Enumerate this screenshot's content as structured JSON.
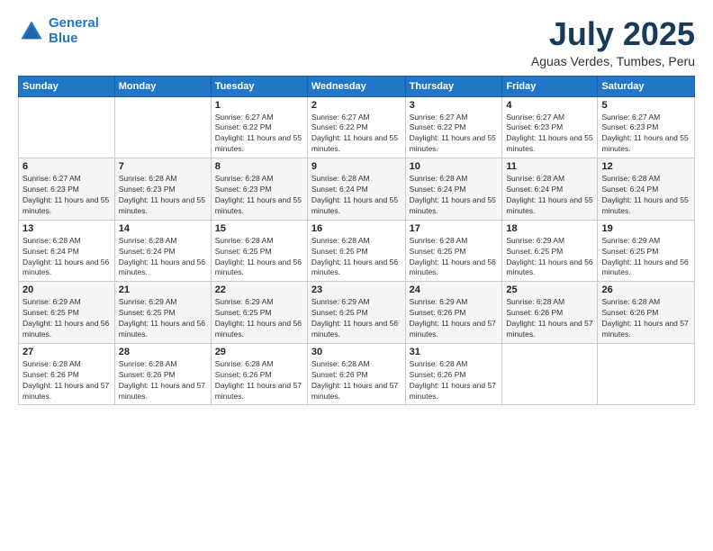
{
  "header": {
    "logo_line1": "General",
    "logo_line2": "Blue",
    "month_title": "July 2025",
    "subtitle": "Aguas Verdes, Tumbes, Peru"
  },
  "days_of_week": [
    "Sunday",
    "Monday",
    "Tuesday",
    "Wednesday",
    "Thursday",
    "Friday",
    "Saturday"
  ],
  "weeks": [
    [
      {
        "day": "",
        "info": ""
      },
      {
        "day": "",
        "info": ""
      },
      {
        "day": "1",
        "info": "Sunrise: 6:27 AM\nSunset: 6:22 PM\nDaylight: 11 hours and 55 minutes."
      },
      {
        "day": "2",
        "info": "Sunrise: 6:27 AM\nSunset: 6:22 PM\nDaylight: 11 hours and 55 minutes."
      },
      {
        "day": "3",
        "info": "Sunrise: 6:27 AM\nSunset: 6:22 PM\nDaylight: 11 hours and 55 minutes."
      },
      {
        "day": "4",
        "info": "Sunrise: 6:27 AM\nSunset: 6:23 PM\nDaylight: 11 hours and 55 minutes."
      },
      {
        "day": "5",
        "info": "Sunrise: 6:27 AM\nSunset: 6:23 PM\nDaylight: 11 hours and 55 minutes."
      }
    ],
    [
      {
        "day": "6",
        "info": "Sunrise: 6:27 AM\nSunset: 6:23 PM\nDaylight: 11 hours and 55 minutes."
      },
      {
        "day": "7",
        "info": "Sunrise: 6:28 AM\nSunset: 6:23 PM\nDaylight: 11 hours and 55 minutes."
      },
      {
        "day": "8",
        "info": "Sunrise: 6:28 AM\nSunset: 6:23 PM\nDaylight: 11 hours and 55 minutes."
      },
      {
        "day": "9",
        "info": "Sunrise: 6:28 AM\nSunset: 6:24 PM\nDaylight: 11 hours and 55 minutes."
      },
      {
        "day": "10",
        "info": "Sunrise: 6:28 AM\nSunset: 6:24 PM\nDaylight: 11 hours and 55 minutes."
      },
      {
        "day": "11",
        "info": "Sunrise: 6:28 AM\nSunset: 6:24 PM\nDaylight: 11 hours and 55 minutes."
      },
      {
        "day": "12",
        "info": "Sunrise: 6:28 AM\nSunset: 6:24 PM\nDaylight: 11 hours and 55 minutes."
      }
    ],
    [
      {
        "day": "13",
        "info": "Sunrise: 6:28 AM\nSunset: 6:24 PM\nDaylight: 11 hours and 56 minutes."
      },
      {
        "day": "14",
        "info": "Sunrise: 6:28 AM\nSunset: 6:24 PM\nDaylight: 11 hours and 56 minutes."
      },
      {
        "day": "15",
        "info": "Sunrise: 6:28 AM\nSunset: 6:25 PM\nDaylight: 11 hours and 56 minutes."
      },
      {
        "day": "16",
        "info": "Sunrise: 6:28 AM\nSunset: 6:25 PM\nDaylight: 11 hours and 56 minutes."
      },
      {
        "day": "17",
        "info": "Sunrise: 6:28 AM\nSunset: 6:25 PM\nDaylight: 11 hours and 56 minutes."
      },
      {
        "day": "18",
        "info": "Sunrise: 6:29 AM\nSunset: 6:25 PM\nDaylight: 11 hours and 56 minutes."
      },
      {
        "day": "19",
        "info": "Sunrise: 6:29 AM\nSunset: 6:25 PM\nDaylight: 11 hours and 56 minutes."
      }
    ],
    [
      {
        "day": "20",
        "info": "Sunrise: 6:29 AM\nSunset: 6:25 PM\nDaylight: 11 hours and 56 minutes."
      },
      {
        "day": "21",
        "info": "Sunrise: 6:29 AM\nSunset: 6:25 PM\nDaylight: 11 hours and 56 minutes."
      },
      {
        "day": "22",
        "info": "Sunrise: 6:29 AM\nSunset: 6:25 PM\nDaylight: 11 hours and 56 minutes."
      },
      {
        "day": "23",
        "info": "Sunrise: 6:29 AM\nSunset: 6:25 PM\nDaylight: 11 hours and 56 minutes."
      },
      {
        "day": "24",
        "info": "Sunrise: 6:29 AM\nSunset: 6:26 PM\nDaylight: 11 hours and 57 minutes."
      },
      {
        "day": "25",
        "info": "Sunrise: 6:28 AM\nSunset: 6:26 PM\nDaylight: 11 hours and 57 minutes."
      },
      {
        "day": "26",
        "info": "Sunrise: 6:28 AM\nSunset: 6:26 PM\nDaylight: 11 hours and 57 minutes."
      }
    ],
    [
      {
        "day": "27",
        "info": "Sunrise: 6:28 AM\nSunset: 6:26 PM\nDaylight: 11 hours and 57 minutes."
      },
      {
        "day": "28",
        "info": "Sunrise: 6:28 AM\nSunset: 6:26 PM\nDaylight: 11 hours and 57 minutes."
      },
      {
        "day": "29",
        "info": "Sunrise: 6:28 AM\nSunset: 6:26 PM\nDaylight: 11 hours and 57 minutes."
      },
      {
        "day": "30",
        "info": "Sunrise: 6:28 AM\nSunset: 6:26 PM\nDaylight: 11 hours and 57 minutes."
      },
      {
        "day": "31",
        "info": "Sunrise: 6:28 AM\nSunset: 6:26 PM\nDaylight: 11 hours and 57 minutes."
      },
      {
        "day": "",
        "info": ""
      },
      {
        "day": "",
        "info": ""
      }
    ]
  ]
}
